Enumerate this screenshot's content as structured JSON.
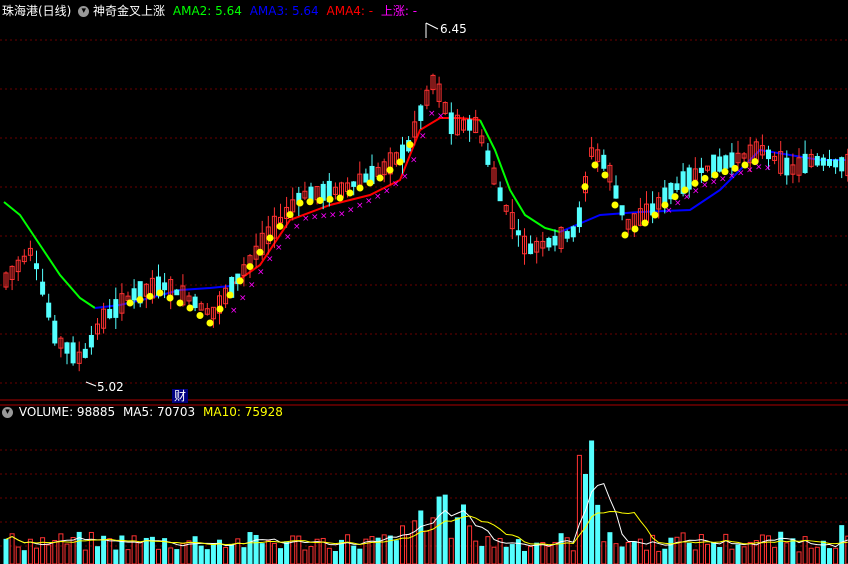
{
  "header": {
    "stock_name": "珠海港(日线)",
    "indicator_name": "神奇金叉上涨",
    "ama2_label": "AMA2: 5.64",
    "ama3_label": "AMA3: 5.64",
    "ama4_label": "AMA4: -",
    "up_label": "上涨: -",
    "colors": {
      "ama2": "#00ff00",
      "ama3": "#0000ff",
      "ama4": "#ff0000",
      "up": "#ff00ff"
    }
  },
  "price_panel": {
    "high_marker": "6.45",
    "low_marker": "5.02",
    "event_tag": "财"
  },
  "volume_panel": {
    "volume_label": "VOLUME: 98885",
    "ma5_label": "MA5: 70703",
    "ma10_label": "MA10: 75928",
    "colors": {
      "ma5": "#ffffff",
      "ma10": "#ffff00"
    }
  },
  "chart_data": {
    "type": "candlestick",
    "high": 6.45,
    "low": 5.02,
    "last_volume": 98885,
    "ma5": 70703,
    "ma10": 75928,
    "ama2": 5.64,
    "ama3": 5.64
  }
}
